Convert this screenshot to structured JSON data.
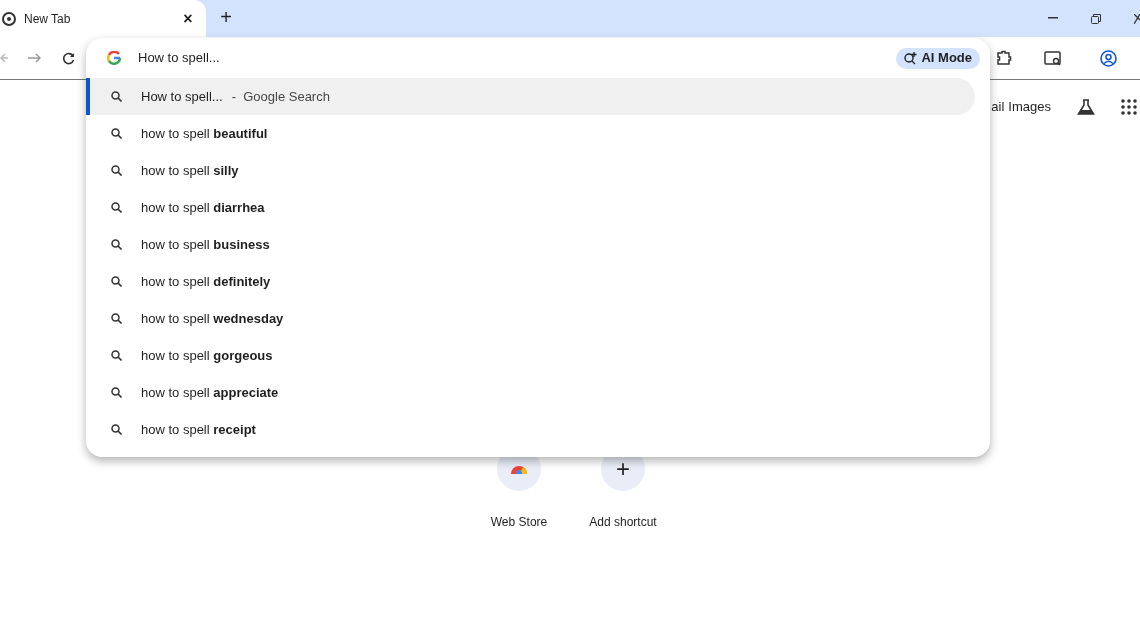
{
  "tab": {
    "title": "New Tab",
    "close": "×",
    "new_tab": "+"
  },
  "omnibox": {
    "value": "How to spell...",
    "ai_mode": "AI Mode"
  },
  "suggestions": [
    {
      "text": "How to spell...",
      "suffix": "-  Google Search",
      "selected": true
    },
    {
      "text": "how to spell **beautiful**",
      "selected": false
    },
    {
      "text": "how to spell **silly**",
      "selected": false
    },
    {
      "text": "how to spell **diarrhea**",
      "selected": false
    },
    {
      "text": "how to spell **business**",
      "selected": false
    },
    {
      "text": "how to spell **definitely**",
      "selected": false
    },
    {
      "text": "how to spell **wednesday**",
      "selected": false
    },
    {
      "text": "how to spell **gorgeous**",
      "selected": false
    },
    {
      "text": "how to spell **appreciate**",
      "selected": false
    },
    {
      "text": "how to spell **receipt**",
      "selected": false
    }
  ],
  "header_links": [
    "ail",
    "Images"
  ],
  "shortcuts": [
    {
      "kind": "store",
      "label": "Web Store"
    },
    {
      "kind": "add",
      "label": "Add shortcut",
      "icon": "+"
    }
  ]
}
